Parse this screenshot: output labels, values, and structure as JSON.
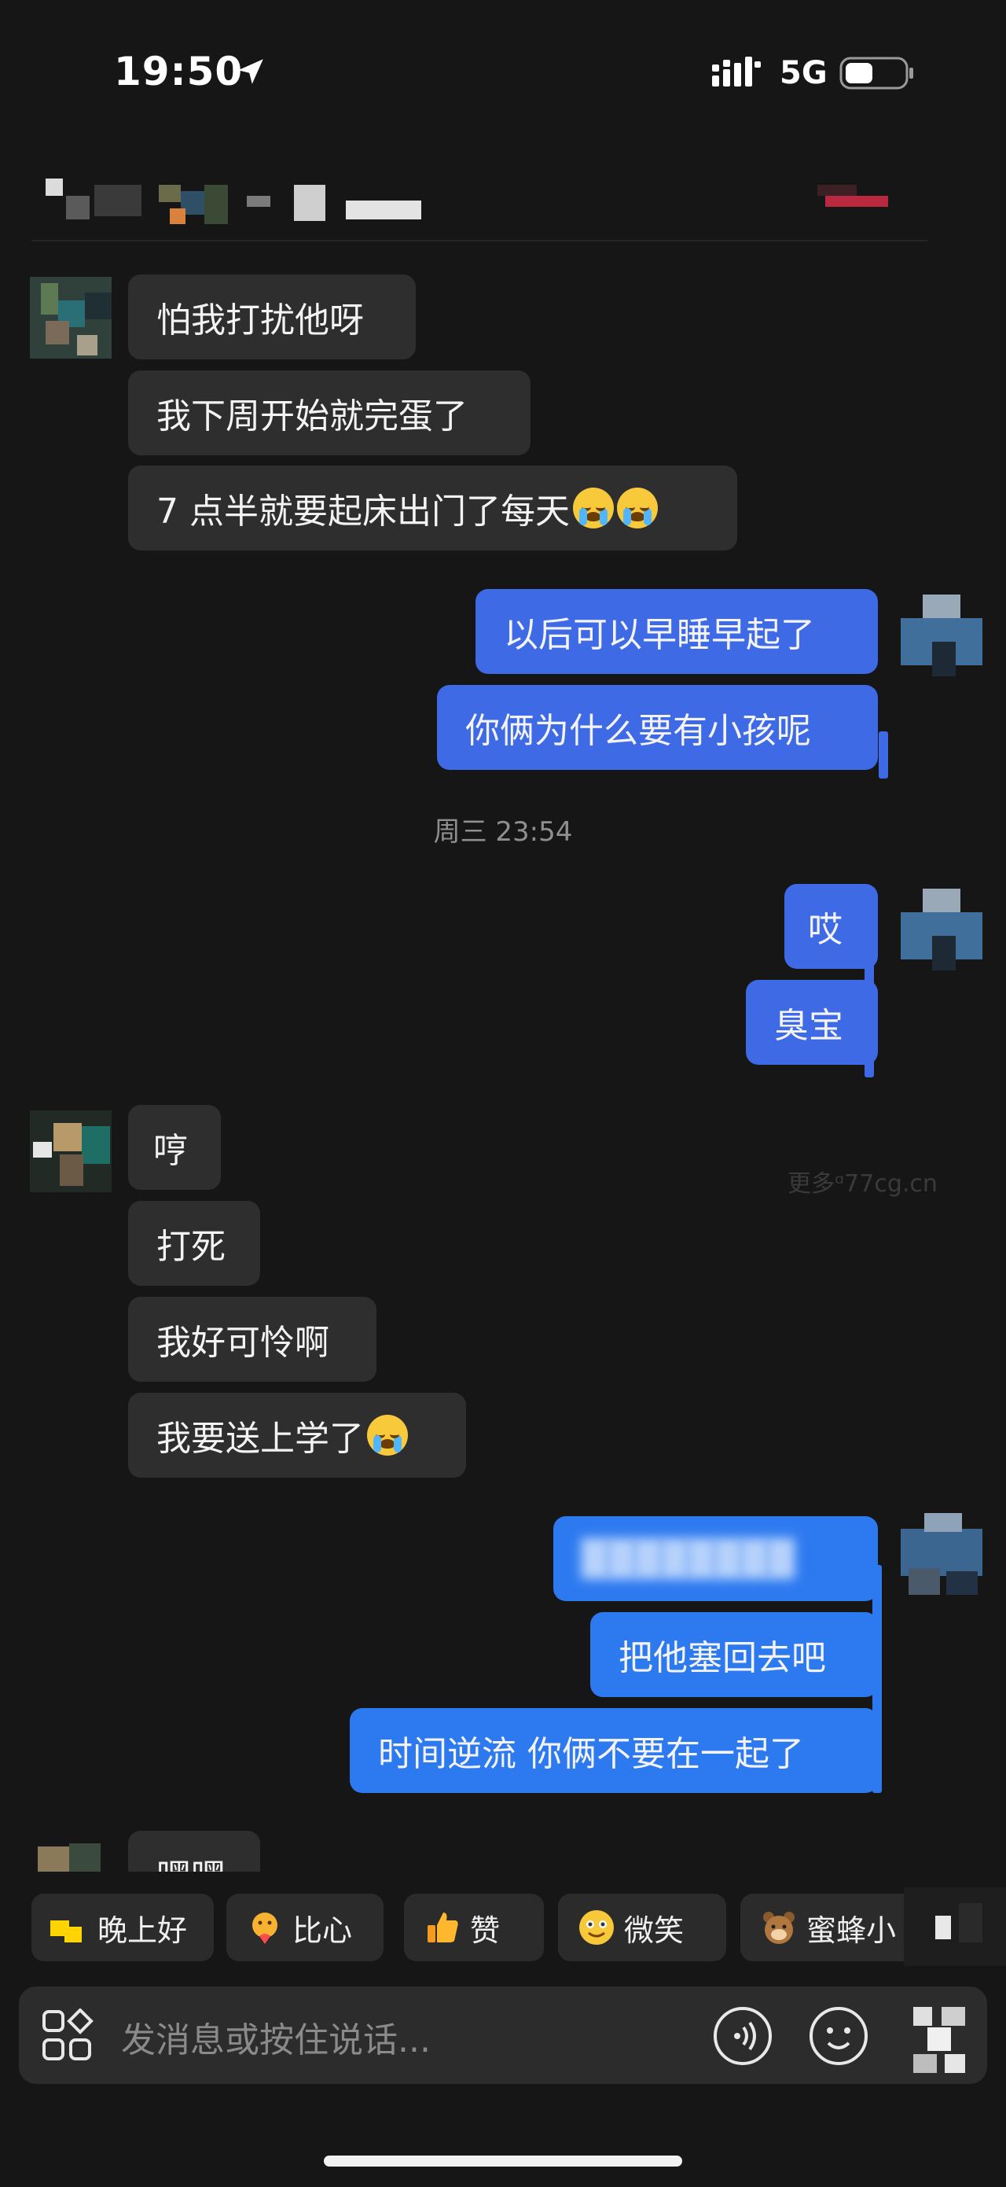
{
  "status_bar": {
    "time": "19:50",
    "network": "5G"
  },
  "conversation": [
    {
      "side": "left",
      "text": "怕我打扰他呀"
    },
    {
      "side": "left",
      "text": "我下周开始就完蛋了"
    },
    {
      "side": "left",
      "text": "7 点半就要起床出门了每天",
      "emoji": [
        "loudly-crying-face",
        "loudly-crying-face"
      ]
    },
    {
      "side": "right",
      "text": "以后可以早睡早起了"
    },
    {
      "side": "right",
      "text": "你俩为什么要有小孩呢"
    },
    {
      "side": "right",
      "text": "哎"
    },
    {
      "side": "right",
      "text": "臭宝"
    },
    {
      "side": "left",
      "text": "哼"
    },
    {
      "side": "left",
      "text": "打死"
    },
    {
      "side": "left",
      "text": "我好可怜啊"
    },
    {
      "side": "left",
      "text": "我要送上学了",
      "emoji": [
        "loudly-crying-face"
      ]
    },
    {
      "side": "right",
      "text": "",
      "redacted": true
    },
    {
      "side": "right",
      "text": "把他塞回去吧"
    },
    {
      "side": "right",
      "text": "时间逆流 你俩不要在一起了"
    },
    {
      "side": "left",
      "text": "嘿嘿"
    }
  ],
  "timestamp": "周三 23:54",
  "watermark": "更多ᵅ77cg.cn",
  "quick_replies": [
    {
      "label": "晚上好",
      "icon": "moon-sticker-icon"
    },
    {
      "label": "比心",
      "icon": "heart-hands-sticker-icon"
    },
    {
      "label": "赞",
      "icon": "thumbs-up-icon"
    },
    {
      "label": "微笑",
      "icon": "smile-face-icon"
    },
    {
      "label": "蜜蜂小",
      "icon": "bee-bear-sticker-icon"
    }
  ],
  "input": {
    "placeholder": "发消息或按住说话..."
  },
  "colors": {
    "background": "#161616",
    "incoming_bubble": "#2e2e2e",
    "outgoing_bubble": "#3f6ae6",
    "outgoing_bubble_alt": "#2d7af0"
  }
}
